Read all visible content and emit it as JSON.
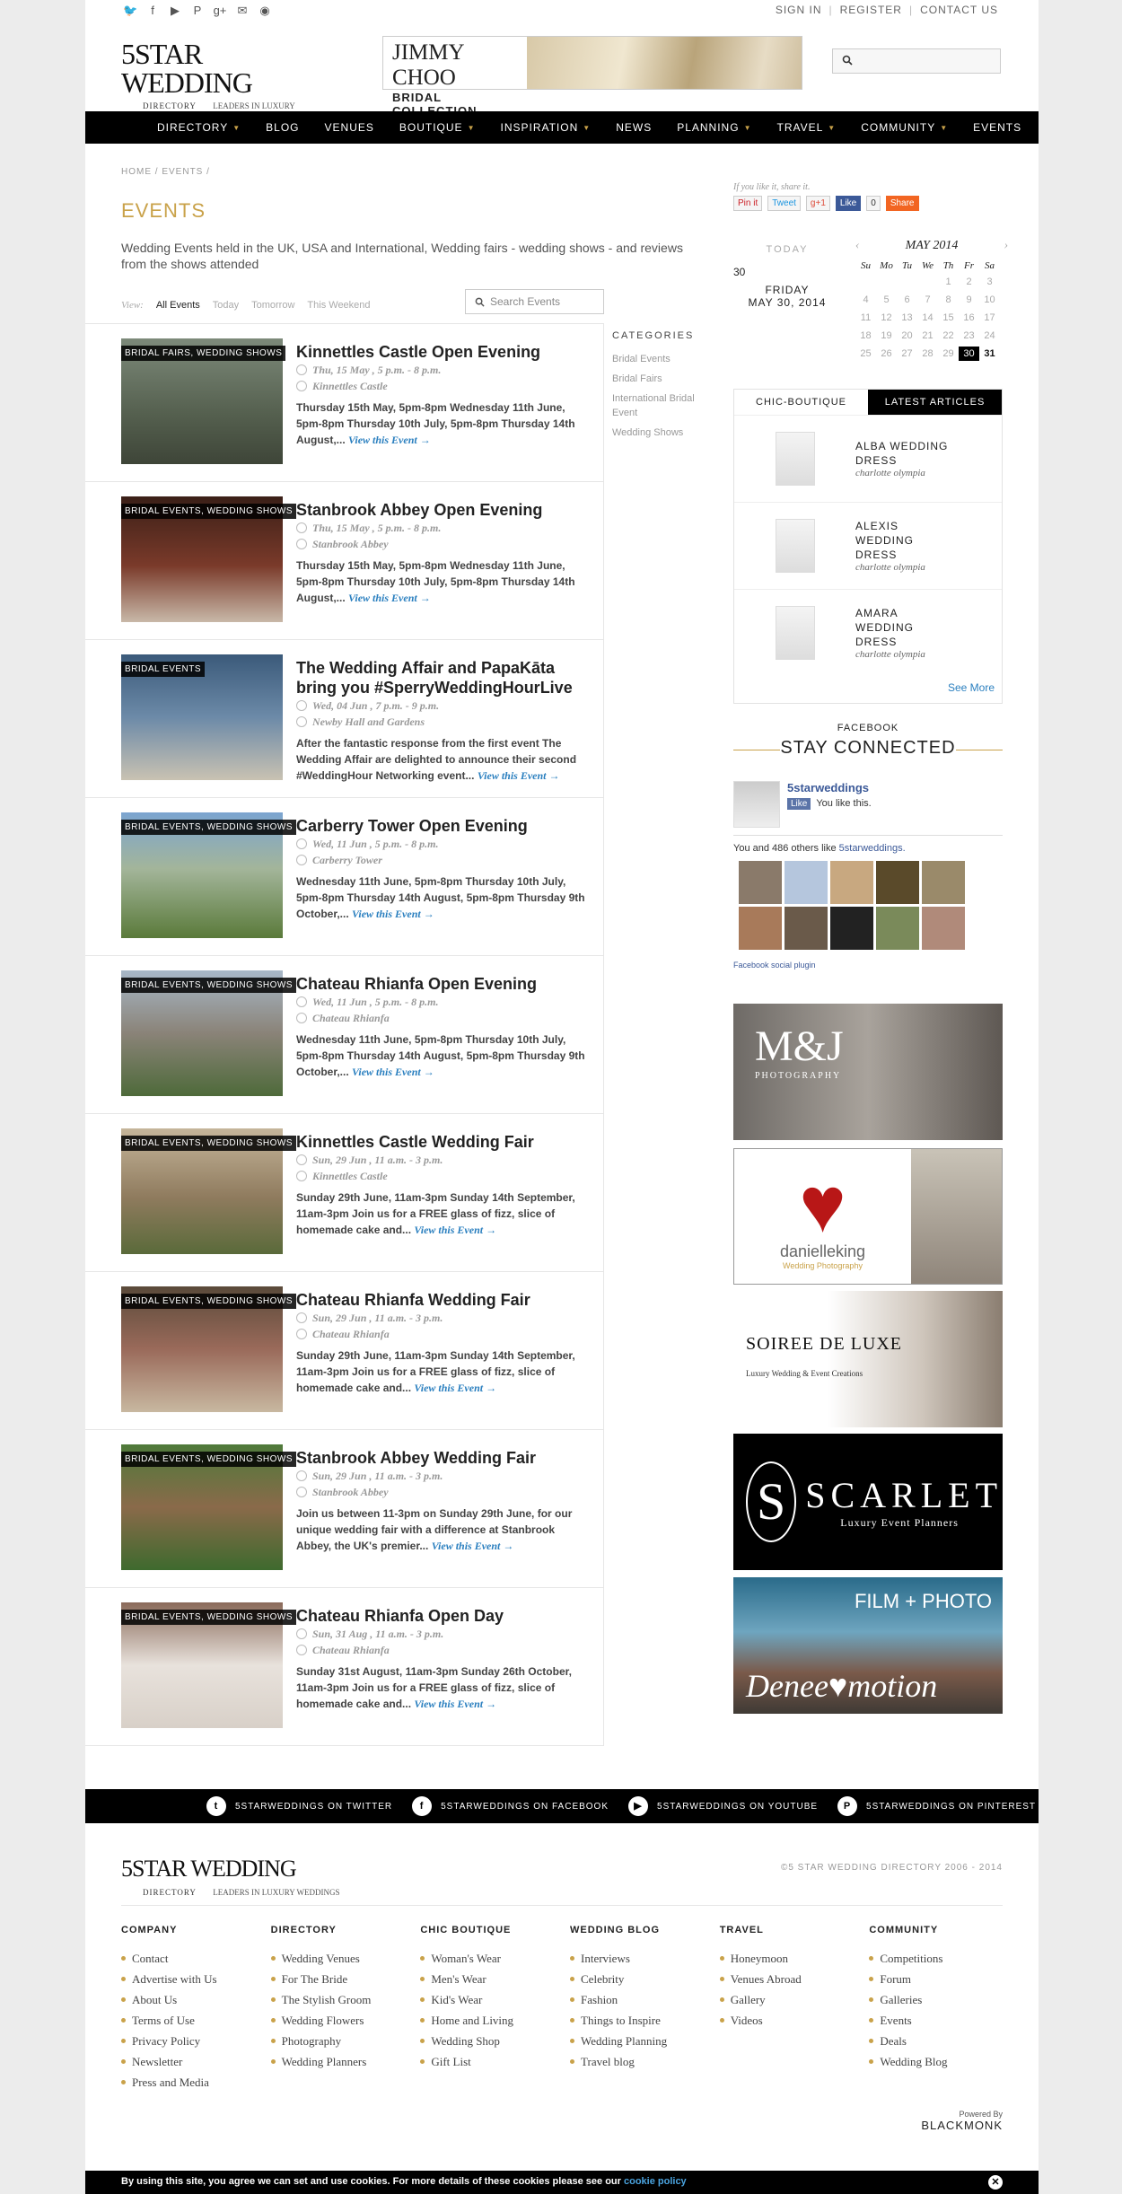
{
  "header": {
    "social_icons": [
      "twitter-icon",
      "facebook-icon",
      "youtube-icon",
      "pinterest-icon",
      "google-plus-icon",
      "email-icon",
      "rss-icon"
    ],
    "links": [
      "SIGN IN",
      "REGISTER",
      "CONTACT US"
    ],
    "logo_main": "5STAR WEDDING",
    "logo_sub": "DIRECTORY",
    "logo_tag": "LEADERS IN LUXURY WEDDINGS",
    "banner_line1": "JIMMY CHOO",
    "banner_line2": "BRIDAL COLLECTION"
  },
  "nav": [
    "DIRECTORY",
    "BLOG",
    "VENUES",
    "BOUTIQUE",
    "INSPIRATION",
    "NEWS",
    "PLANNING",
    "TRAVEL",
    "COMMUNITY",
    "EVENTS"
  ],
  "breadcrumb": "HOME / EVENTS /",
  "page_title": "EVENTS",
  "intro": "Wedding  Events held in the UK, USA and International, Wedding fairs - wedding shows - and reviews from the shows attended",
  "view_filters": {
    "label": "View:",
    "items": [
      "All Events",
      "Today",
      "Tomorrow",
      "This Weekend"
    ]
  },
  "event_search_placeholder": "Search Events",
  "events": [
    {
      "badge": "BRIDAL FAIRS, WEDDING SHOWS",
      "title": "Kinnettles Castle Open Evening",
      "date": "Thu, 15 May , 5 p.m. - 8 p.m.",
      "venue": "Kinnettles Castle",
      "desc": "Thursday 15th May, 5pm-8pm Wednesday 11th June, 5pm-8pm Thursday 10th July, 5pm-8pm Thursday 14th August,...",
      "more": "View this Event →"
    },
    {
      "badge": "BRIDAL EVENTS, WEDDING SHOWS",
      "title": "Stanbrook Abbey Open Evening",
      "date": "Thu, 15 May , 5 p.m. - 8 p.m.",
      "venue": "Stanbrook Abbey",
      "desc": "Thursday 15th May, 5pm-8pm Wednesday 11th June, 5pm-8pm Thursday 10th July, 5pm-8pm Thursday 14th August,...",
      "more": "View this Event →"
    },
    {
      "badge": "BRIDAL EVENTS",
      "title": "The Wedding Affair and PapaKāta bring you #SperryWeddingHourLive",
      "date": "Wed, 04 Jun , 7 p.m. - 9 p.m.",
      "venue": "Newby Hall and Gardens",
      "desc": "After the fantastic response from the first event The Wedding Affair are delighted to announce their second #WeddingHour Networking event...",
      "more": "View this Event →"
    },
    {
      "badge": "BRIDAL EVENTS, WEDDING SHOWS",
      "title": "Carberry Tower Open Evening",
      "date": "Wed, 11 Jun , 5 p.m. - 8 p.m.",
      "venue": "Carberry Tower",
      "desc": "Wednesday 11th June, 5pm-8pm Thursday 10th July, 5pm-8pm Thursday 14th August, 5pm-8pm Thursday 9th October,...",
      "more": "View this Event →"
    },
    {
      "badge": "BRIDAL EVENTS, WEDDING SHOWS",
      "title": "Chateau Rhianfa Open Evening",
      "date": "Wed, 11 Jun , 5 p.m. - 8 p.m.",
      "venue": "Chateau Rhianfa",
      "desc": "Wednesday 11th June, 5pm-8pm Thursday 10th July, 5pm-8pm Thursday 14th August, 5pm-8pm Thursday 9th October,...",
      "more": "View this Event →"
    },
    {
      "badge": "BRIDAL EVENTS, WEDDING SHOWS",
      "title": "Kinnettles Castle Wedding Fair",
      "date": "Sun, 29 Jun , 11 a.m. - 3 p.m.",
      "venue": "Kinnettles Castle",
      "desc": "Sunday 29th June, 11am-3pm Sunday 14th September, 11am-3pm Join us for a FREE glass of fizz, slice of homemade cake and...",
      "more": "View this Event →"
    },
    {
      "badge": "BRIDAL EVENTS, WEDDING SHOWS",
      "title": "Chateau Rhianfa Wedding Fair",
      "date": "Sun, 29 Jun , 11 a.m. - 3 p.m.",
      "venue": "Chateau Rhianfa",
      "desc": "Sunday 29th June, 11am-3pm Sunday 14th September, 11am-3pm Join us for a FREE glass of fizz, slice of homemade cake and...",
      "more": "View this Event →"
    },
    {
      "badge": "BRIDAL EVENTS, WEDDING SHOWS",
      "title": "Stanbrook Abbey Wedding Fair",
      "date": "Sun, 29 Jun , 11 a.m. - 3 p.m.",
      "venue": "Stanbrook Abbey",
      "desc": "Join us between 11-3pm on Sunday 29th June, for our unique wedding fair with a difference at Stanbrook Abbey, the UK's premier...",
      "more": "View this Event →"
    },
    {
      "badge": "BRIDAL EVENTS, WEDDING SHOWS",
      "title": "Chateau Rhianfa Open Day",
      "date": "Sun, 31 Aug , 11 a.m. - 3 p.m.",
      "venue": "Chateau Rhianfa",
      "desc": "Sunday 31st August, 11am-3pm Sunday 26th October, 11am-3pm Join us for a FREE glass of fizz, slice of homemade cake and...",
      "more": "View this Event →"
    }
  ],
  "categories": {
    "title": "CATEGORIES",
    "items": [
      "Bridal Events",
      "Bridal Fairs",
      "International Bridal Event",
      "Wedding Shows"
    ]
  },
  "share": {
    "note": "If you like it, share it.",
    "buttons": [
      "Pin it",
      "Tweet",
      "g+1",
      "Like",
      "0",
      "Share"
    ]
  },
  "today": {
    "label": "TODAY",
    "num": "30",
    "weekday": "FRIDAY",
    "date": "MAY 30, 2014"
  },
  "calendar": {
    "month": "MAY 2014",
    "prev": "‹",
    "next": "›",
    "days": [
      "Su",
      "Mo",
      "Tu",
      "We",
      "Th",
      "Fr",
      "Sa"
    ],
    "cells": [
      "",
      "",
      "",
      "",
      "1",
      "2",
      "3",
      "4",
      "5",
      "6",
      "7",
      "8",
      "9",
      "10",
      "11",
      "12",
      "13",
      "14",
      "15",
      "16",
      "17",
      "18",
      "19",
      "20",
      "21",
      "22",
      "23",
      "24",
      "25",
      "26",
      "27",
      "28",
      "29",
      "30",
      "31"
    ],
    "current": "30"
  },
  "tabs": [
    "CHIC-BOUTIQUE",
    "LATEST ARTICLES"
  ],
  "products": [
    {
      "name": "ALBA WEDDING DRESS",
      "by": "charlotte olympia"
    },
    {
      "name": "ALEXIS WEDDING DRESS",
      "by": "charlotte olympia"
    },
    {
      "name": "AMARA WEDDING DRESS",
      "by": "charlotte olympia"
    }
  ],
  "see_more": "See More",
  "facebook": {
    "label": "FACEBOOK",
    "heading": "STAY CONNECTED",
    "page": "5starweddings",
    "like": "Like",
    "you_like": "You like this.",
    "count_prefix": "You and 486 others like ",
    "count_link": "5starweddings.",
    "plugin": "Facebook social plugin"
  },
  "ads": {
    "mj": "M&J",
    "mj_sub": "PHOTOGRAPHY",
    "dk": "danielleking",
    "dk_sub": "Wedding Photography",
    "sdl": "SOIREE DE LUXE",
    "sdl_sub": "Luxury Wedding & Event Creations",
    "sc_letter": "S",
    "sc": "SCARLET",
    "sc_sub": "Luxury Event Planners",
    "dn_top": "FILM + PHOTO",
    "dn": "Denee♥motion"
  },
  "social_bar": [
    {
      "icon": "twitter-icon",
      "label": "5STARWEDDINGS ON TWITTER"
    },
    {
      "icon": "facebook-icon",
      "label": "5STARWEDDINGS ON FACEBOOK"
    },
    {
      "icon": "youtube-icon",
      "label": "5STARWEDDINGS ON YOUTUBE"
    },
    {
      "icon": "pinterest-icon",
      "label": "5STARWEDDINGS ON PINTEREST"
    }
  ],
  "copyright": "©5 STAR WEDDING DIRECTORY 2006 - 2014",
  "footer_cols": [
    {
      "title": "COMPANY",
      "items": [
        "Contact",
        "Advertise with Us",
        "About Us",
        "Terms of Use",
        "Privacy Policy",
        "Newsletter",
        "Press and Media"
      ]
    },
    {
      "title": "DIRECTORY",
      "items": [
        "Wedding Venues",
        "For The Bride",
        "The Stylish Groom",
        "Wedding Flowers",
        "Photography",
        "Wedding Planners"
      ]
    },
    {
      "title": "CHIC BOUTIQUE",
      "items": [
        "Woman's Wear",
        "Men's Wear",
        "Kid's Wear",
        "Home and Living",
        "Wedding Shop",
        "Gift List"
      ]
    },
    {
      "title": "WEDDING BLOG",
      "items": [
        "Interviews",
        "Celebrity",
        "Fashion",
        "Things to Inspire",
        "Wedding Planning",
        "Travel blog"
      ]
    },
    {
      "title": "TRAVEL",
      "items": [
        "Honeymoon",
        "Venues Abroad",
        "Gallery",
        "Videos"
      ]
    },
    {
      "title": "COMMUNITY",
      "items": [
        "Competitions",
        "Forum",
        "Galleries",
        "Events",
        "Deals",
        "Wedding Blog"
      ]
    }
  ],
  "powered": {
    "label": "Powered By",
    "brand": "BLACKMONK"
  },
  "cookie": {
    "text": "By using this site, you agree we can set and use cookies. For more details of these cookies please see our ",
    "link": "cookie policy",
    "close": "✕"
  },
  "colors": {
    "accent": "#c9a24a",
    "link": "#2a7fbf",
    "nav_bg": "#000000"
  }
}
